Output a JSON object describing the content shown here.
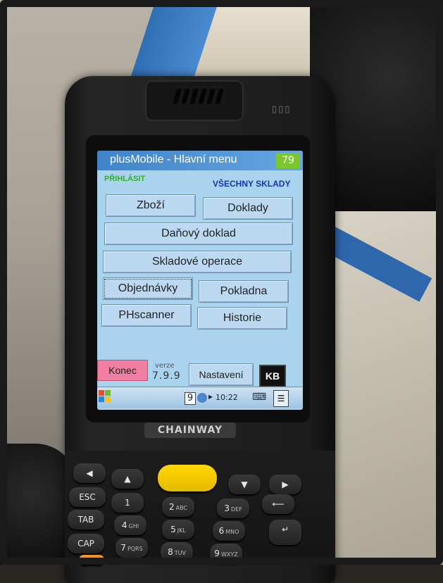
{
  "app": {
    "title": "plusMobile - Hlavní menu",
    "battery": "79"
  },
  "header": {
    "login_label": "PŘIHLÁSIT",
    "warehouse_label": "VŠECHNY SKLADY"
  },
  "menu": {
    "zbozi": "Zboží",
    "doklady": "Doklady",
    "danovy_doklad": "Daňový doklad",
    "skladove_operace": "Skladové operace",
    "objednavky": "Objednávky",
    "pokladna": "Pokladna",
    "phscanner": "PHscanner",
    "historie": "Historie"
  },
  "footer": {
    "konec": "Konec",
    "version_label": "verze",
    "version": "7.9.9",
    "nastaveni": "Nastavení",
    "kb": "KB"
  },
  "taskbar": {
    "tray_number": "9",
    "clock": "10:22"
  },
  "device": {
    "brand": "CHAINWAY"
  },
  "keypad": {
    "esc": "ESC",
    "tab": "TAB",
    "cap": "CAP",
    "k1": "1",
    "k2": "2",
    "k2_sub": "ABC",
    "k3": "3",
    "k3_sub": "DEF",
    "k4": "4",
    "k4_sub": "GHI",
    "k5": "5",
    "k5_sub": "JKL",
    "k6": "6",
    "k6_sub": "MNO",
    "k7": "7",
    "k7_sub": "PQRS",
    "k8": "8",
    "k8_sub": "TUV",
    "k9": "9",
    "k9_sub": "WXYZ"
  },
  "colors": {
    "screen_bg": "#aad3ee",
    "title_bar": "#4a90d4",
    "battery": "#7ac82e",
    "login": "#31b02a",
    "warehouse": "#1536b0",
    "konec": "#f07fa2",
    "scan_key": "#ffd800"
  }
}
